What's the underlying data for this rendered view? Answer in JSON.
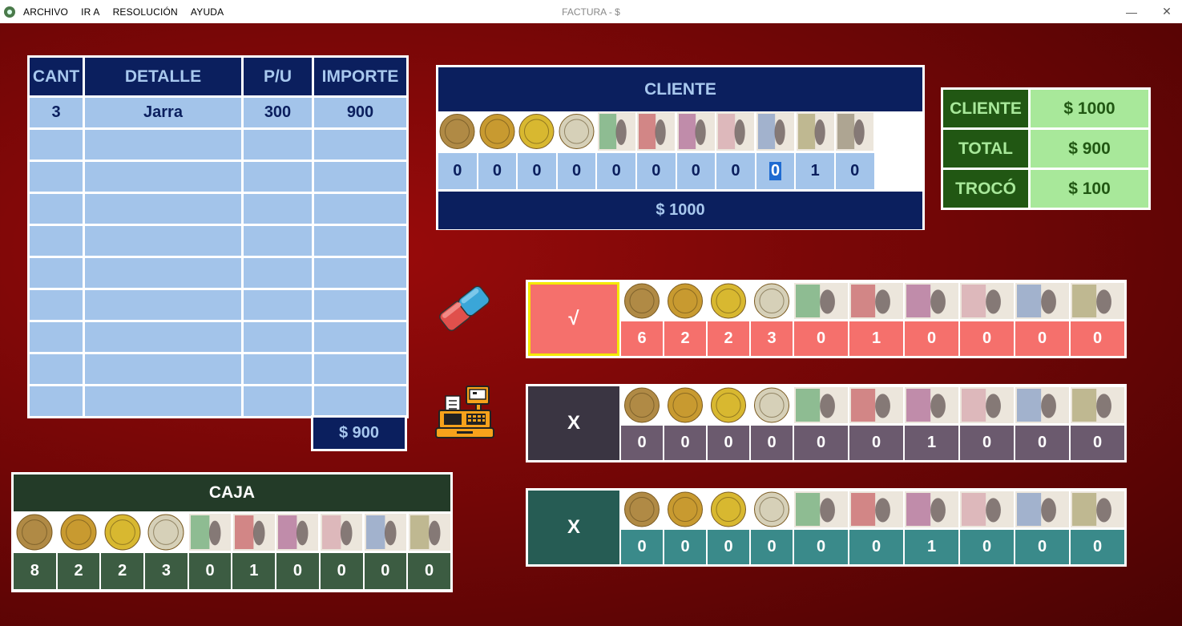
{
  "window": {
    "title": "FACTURA - $",
    "menu": [
      "ARCHIVO",
      "IR A",
      "RESOLUCIÓN",
      "AYUDA"
    ],
    "minimize_icon": "minimize-icon",
    "close_icon": "close-icon"
  },
  "factura": {
    "headers": [
      "CANT",
      "DETALLE",
      "P/U",
      "IMPORTE"
    ],
    "rows": [
      [
        "3",
        "Jarra",
        "300",
        "900"
      ],
      [
        "",
        "",
        "",
        ""
      ],
      [
        "",
        "",
        "",
        ""
      ],
      [
        "",
        "",
        "",
        ""
      ],
      [
        "",
        "",
        "",
        ""
      ],
      [
        "",
        "",
        "",
        ""
      ],
      [
        "",
        "",
        "",
        ""
      ],
      [
        "",
        "",
        "",
        ""
      ],
      [
        "",
        "",
        "",
        ""
      ],
      [
        "",
        "",
        "",
        ""
      ]
    ],
    "total": "$ 900"
  },
  "denominations": [
    {
      "value": 1,
      "kind": "coin",
      "color": "#b08a45"
    },
    {
      "value": 2,
      "kind": "coin",
      "color": "#c89a30"
    },
    {
      "value": 5,
      "kind": "coin",
      "color": "#d8b830"
    },
    {
      "value": 10,
      "kind": "coin",
      "color": "#d6d0b8"
    },
    {
      "value": 20,
      "kind": "bill",
      "color": "#6fae7a"
    },
    {
      "value": 50,
      "kind": "bill",
      "color": "#c9666a"
    },
    {
      "value": 100,
      "kind": "bill",
      "color": "#b26e9a"
    },
    {
      "value": 200,
      "kind": "bill",
      "color": "#d8a8b0"
    },
    {
      "value": 500,
      "kind": "bill",
      "color": "#8aa0c8"
    },
    {
      "value": 1000,
      "kind": "bill",
      "color": "#b0a878"
    },
    {
      "value": 2000,
      "kind": "bill",
      "color": "#9a8f7a"
    }
  ],
  "cliente": {
    "title": "CLIENTE",
    "counts": [
      "0",
      "0",
      "0",
      "0",
      "0",
      "0",
      "0",
      "0",
      "0",
      "1",
      "0"
    ],
    "selected_index": 8,
    "total": "$ 1000"
  },
  "summary": {
    "cliente_label": "CLIENTE",
    "cliente_value": "$ 1000",
    "total_label": "TOTAL",
    "total_value": "$ 900",
    "troco_label": "TROCÓ",
    "troco_value": "$ 100"
  },
  "icons": {
    "eraser": "eraser-icon",
    "register": "cash-register-icon"
  },
  "answers": [
    {
      "mark": "√",
      "counts": [
        "6",
        "2",
        "2",
        "3",
        "0",
        "1",
        "0",
        "0",
        "0",
        "0"
      ],
      "color": "#f5706c"
    },
    {
      "mark": "X",
      "counts": [
        "0",
        "0",
        "0",
        "0",
        "0",
        "0",
        "1",
        "0",
        "0",
        "0"
      ],
      "color": "#6b5a6e"
    },
    {
      "mark": "X",
      "counts": [
        "0",
        "0",
        "0",
        "0",
        "0",
        "0",
        "1",
        "0",
        "0",
        "0"
      ],
      "color": "#3a8a8a"
    }
  ],
  "caja": {
    "title": "CAJA",
    "counts": [
      "8",
      "2",
      "2",
      "3",
      "0",
      "1",
      "0",
      "0",
      "0",
      "0"
    ]
  }
}
